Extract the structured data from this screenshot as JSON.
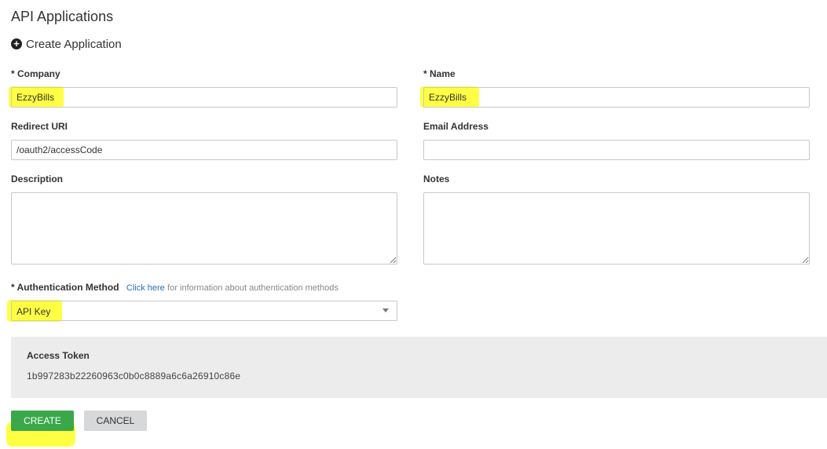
{
  "page": {
    "title": "API Applications",
    "create_section_label": "Create Application"
  },
  "form": {
    "company": {
      "label": "* Company",
      "value": "EzzyBills"
    },
    "name": {
      "label": "* Name",
      "value": "EzzyBills"
    },
    "redirect_uri": {
      "label": "Redirect URI",
      "value": "/oauth2/accessCode"
    },
    "email": {
      "label": "Email Address",
      "value": ""
    },
    "description": {
      "label": "Description",
      "value": ""
    },
    "notes": {
      "label": "Notes",
      "value": ""
    },
    "auth_method": {
      "label": "* Authentication Method",
      "link_text": "Click here",
      "info_text": "for information about authentication methods",
      "selected": "API Key"
    }
  },
  "access_token": {
    "label": "Access Token",
    "value": "1b997283b22260963c0b0c8889a6c6a26910c86e"
  },
  "buttons": {
    "create": "CREATE",
    "cancel": "CANCEL"
  },
  "colors": {
    "highlight": "#ffff3a",
    "create_button": "#3aa84a",
    "cancel_button": "#d6d8da",
    "link": "#2a6fb7",
    "token_panel": "#ececec"
  },
  "icons": {
    "create_section": "plus-circle-icon",
    "select_arrow": "caret-down-icon"
  }
}
